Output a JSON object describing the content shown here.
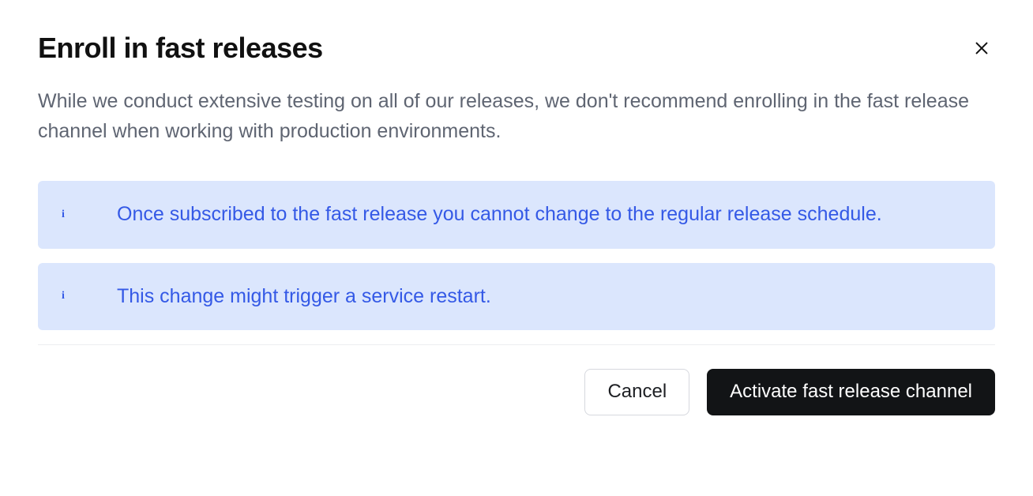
{
  "dialog": {
    "title": "Enroll in fast releases",
    "description": "While we conduct extensive testing on all of our releases, we don't recommend enrolling in the fast release channel when working with production environments.",
    "banners": [
      "Once subscribed to the fast release you cannot change to the regular release schedule.",
      "This change might trigger a service restart."
    ],
    "footer": {
      "cancel_label": "Cancel",
      "confirm_label": "Activate fast release channel"
    }
  }
}
